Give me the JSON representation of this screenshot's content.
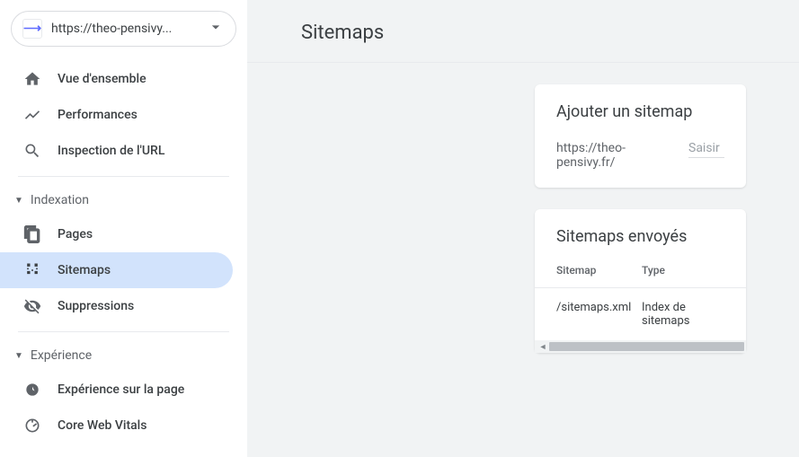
{
  "property": {
    "url": "https://theo-pensivy..."
  },
  "nav": {
    "overview": "Vue d'ensemble",
    "performance": "Performances",
    "url_inspection": "Inspection de l'URL",
    "section_indexing": "Indexation",
    "pages": "Pages",
    "sitemaps": "Sitemaps",
    "removals": "Suppressions",
    "section_experience": "Expérience",
    "page_experience": "Expérience sur la page",
    "core_web_vitals": "Core Web Vitals"
  },
  "page": {
    "title": "Sitemaps"
  },
  "add_card": {
    "title": "Ajouter un sitemap",
    "url_prefix": "https://theo-pensivy.fr/",
    "placeholder": "Saisir"
  },
  "sent_card": {
    "title": "Sitemaps envoyés",
    "col_sitemap": "Sitemap",
    "col_type": "Type",
    "row": {
      "sitemap": "/sitemaps.xml",
      "type": "Index de sitemaps"
    }
  }
}
